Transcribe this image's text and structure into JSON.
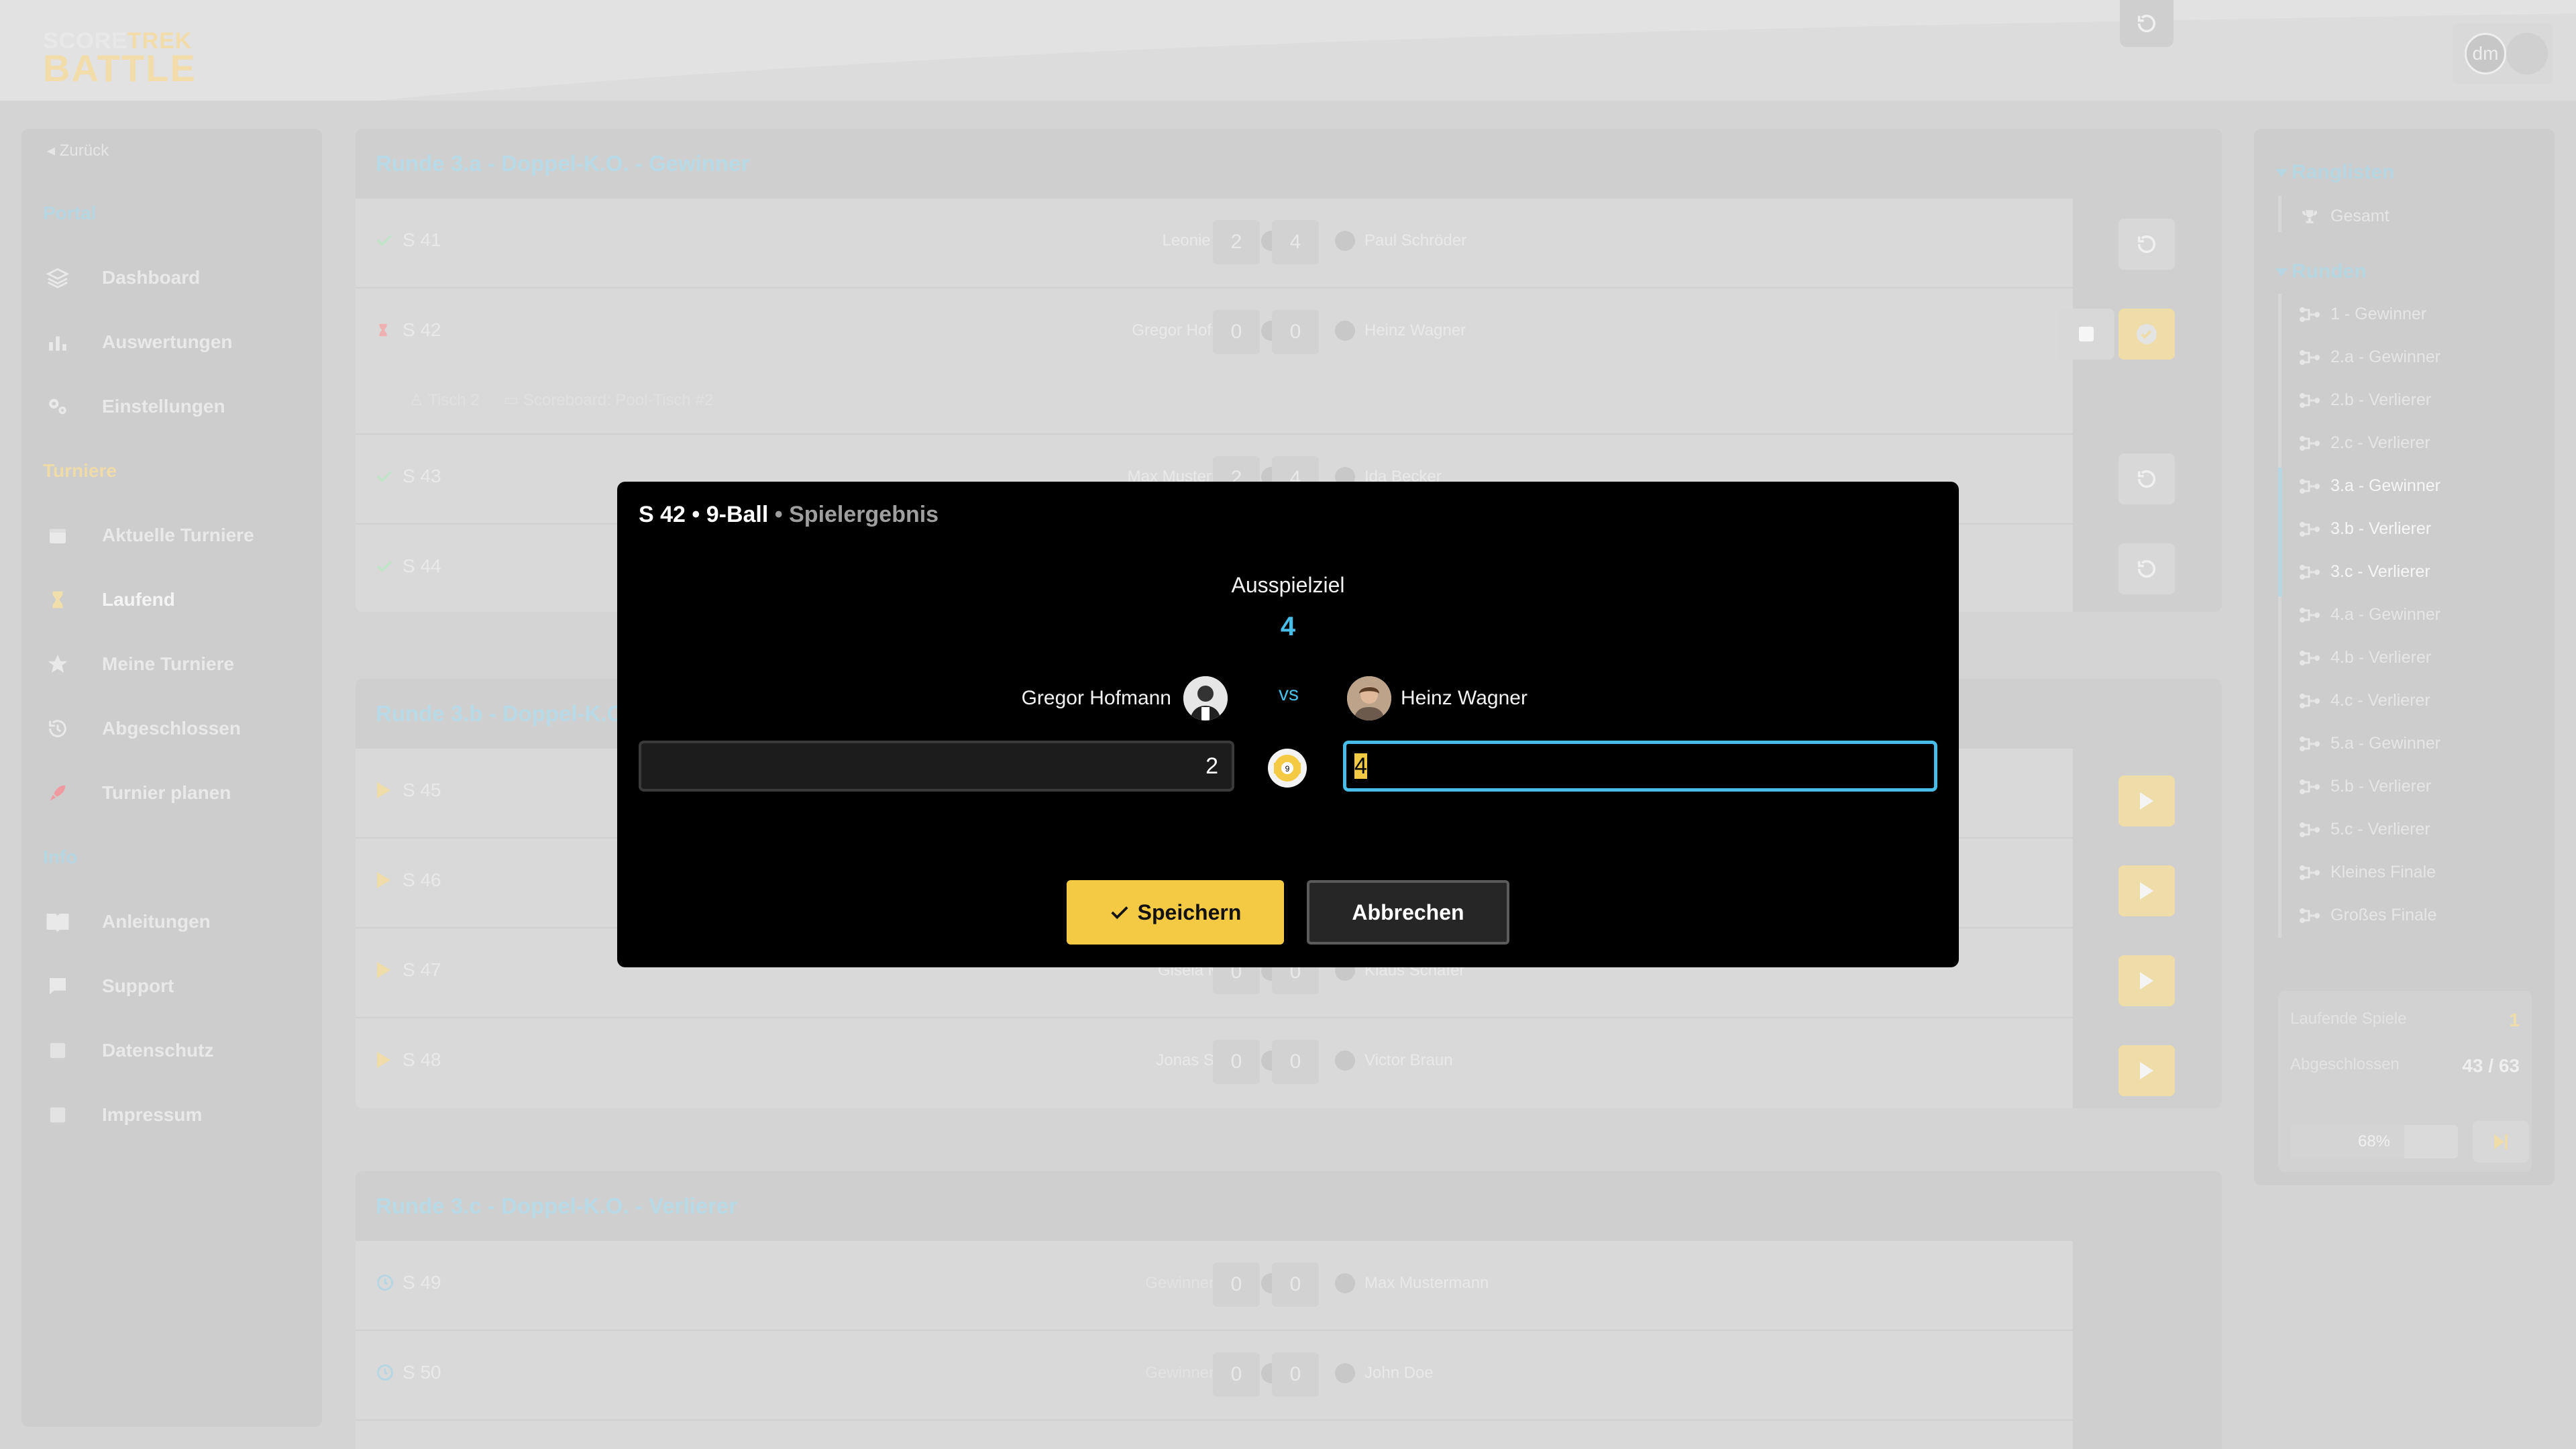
{
  "brand": {
    "line1a": "SCORE",
    "line1b": "TREK",
    "line2": "BATTLE"
  },
  "user": {
    "initials": "dm"
  },
  "sidebar": {
    "back": "Zurück",
    "sections": {
      "portal": "Portal",
      "turniere": "Turniere",
      "info": "Info"
    },
    "items": [
      {
        "label": "Dashboard",
        "icon": "layers-icon"
      },
      {
        "label": "Auswertungen",
        "icon": "bar-chart-icon"
      },
      {
        "label": "Einstellungen",
        "icon": "gears-icon"
      },
      {
        "label": "Aktuelle Turniere",
        "icon": "calendar-icon"
      },
      {
        "label": "Laufend",
        "icon": "hourglass-icon"
      },
      {
        "label": "Meine Turniere",
        "icon": "star-icon"
      },
      {
        "label": "Abgeschlossen",
        "icon": "history-icon"
      },
      {
        "label": "Turnier planen",
        "icon": "rocket-icon"
      },
      {
        "label": "Anleitungen",
        "icon": "book-icon"
      },
      {
        "label": "Support",
        "icon": "chat-icon"
      },
      {
        "label": "Datenschutz",
        "icon": "shield-icon"
      },
      {
        "label": "Impressum",
        "icon": "info-box-icon"
      }
    ]
  },
  "rounds": [
    {
      "title": "Runde 3.a - Doppel-K.O. - Gewinner",
      "matches": [
        {
          "id": "S 41",
          "status": "done",
          "p1": "Leonie Koch",
          "s1": "2",
          "s2": "4",
          "p2": "Paul Schröder"
        },
        {
          "id": "S 42",
          "status": "running",
          "p1": "Gregor Hofmann",
          "s1": "0",
          "s2": "0",
          "p2": "Heinz Wagner",
          "table": "Tisch 2",
          "scoreboard": "Scoreboard: Pool-Tisch #2"
        },
        {
          "id": "S 43",
          "status": "done",
          "p1": "Max Mustermann",
          "s1": "2",
          "s2": "4",
          "p2": "Ida Becker"
        },
        {
          "id": "S 44",
          "status": "done",
          "p1": "",
          "s1": "",
          "s2": "",
          "p2": ""
        }
      ]
    },
    {
      "title": "Runde 3.b - Doppel-K.O. - Verlierer",
      "matches": [
        {
          "id": "S 45",
          "status": "ready"
        },
        {
          "id": "S 46",
          "status": "ready"
        },
        {
          "id": "S 47",
          "status": "ready",
          "p1": "Gisela Müller",
          "s1": "0",
          "s2": "0",
          "p2": "Klaus Schäfer"
        },
        {
          "id": "S 48",
          "status": "ready",
          "p1": "Jonas Schulz",
          "s1": "0",
          "s2": "0",
          "p2": "Victor Braun"
        }
      ]
    },
    {
      "title": "Runde 3.c - Doppel-K.O. - Verlierer",
      "matches": [
        {
          "id": "S 49",
          "status": "waiting",
          "p1": "Gewinner S 45",
          "s1": "0",
          "s2": "0",
          "p2": "Max Mustermann"
        },
        {
          "id": "S 50",
          "status": "waiting",
          "p1": "Gewinner S 46",
          "s1": "0",
          "s2": "0",
          "p2": "John Doe"
        }
      ]
    }
  ],
  "right": {
    "ranglisten": "Ranglisten",
    "gesamt": "Gesamt",
    "runden": "Runden",
    "round_items": [
      "1 - Gewinner",
      "2.a - Gewinner",
      "2.b - Verlierer",
      "2.c - Verlierer",
      "3.a - Gewinner",
      "3.b - Verlierer",
      "3.c - Verlierer",
      "4.a - Gewinner",
      "4.b - Verlierer",
      "4.c - Verlierer",
      "5.a - Gewinner",
      "5.b - Verlierer",
      "5.c - Verlierer",
      "Kleines Finale",
      "Großes Finale"
    ],
    "stats": {
      "running_label": "Laufende Spiele",
      "running_value": "1",
      "done_label": "Abgeschlossen",
      "done_value": "43 / 63",
      "progress_text": "68%",
      "progress": 0.68
    }
  },
  "modal": {
    "title_bold": "S 42 • 9-Ball",
    "title_gray": " • Spielergebnis",
    "target_label": "Ausspielziel",
    "target_value": "4",
    "player1": "Gregor Hofmann",
    "player2": "Heinz Wagner",
    "vs": "vs",
    "score1": "2",
    "score2": "4",
    "save": "Speichern",
    "cancel": "Abbrechen"
  }
}
